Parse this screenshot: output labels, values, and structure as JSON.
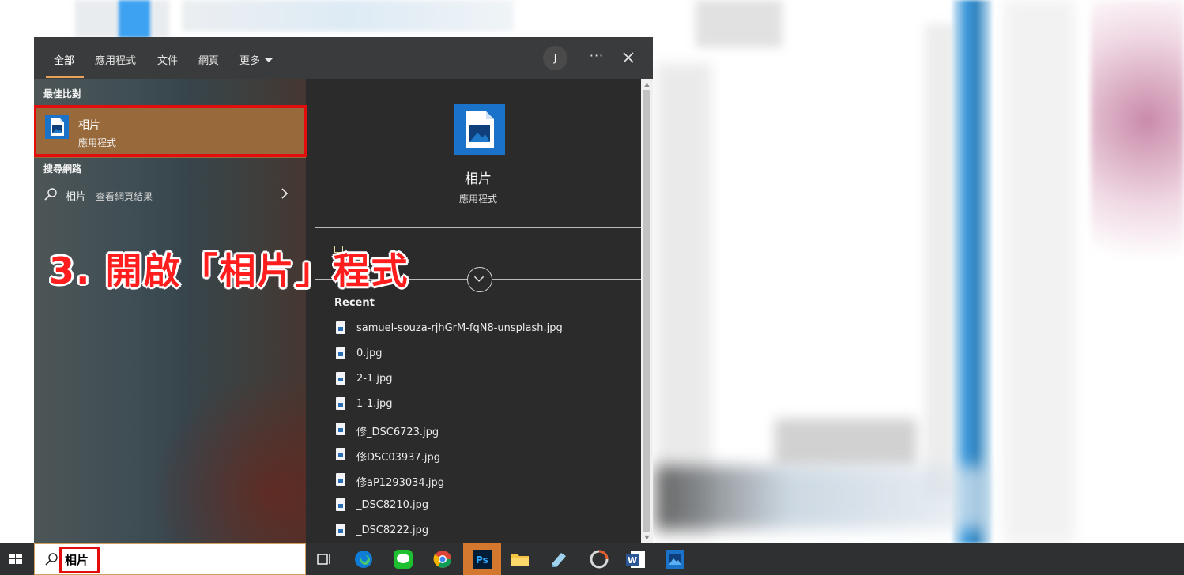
{
  "tabs": [
    {
      "label": "全部",
      "active": true
    },
    {
      "label": "應用程式"
    },
    {
      "label": "文件"
    },
    {
      "label": "網頁"
    },
    {
      "label": "更多"
    }
  ],
  "header": {
    "avatar_initial": "J",
    "more_options": "···"
  },
  "best_match": {
    "section_label": "最佳比對",
    "title": "相片",
    "subtitle": "應用程式"
  },
  "web_search": {
    "section_label": "搜尋網路",
    "query": "相片",
    "suffix": " - 查看網頁結果"
  },
  "detail": {
    "title": "相片",
    "subtitle": "應用程式",
    "recent_title": "Recent",
    "recent_files": [
      "samuel-souza-rjhGrM-fqN8-unsplash.jpg",
      "0.jpg",
      "2-1.jpg",
      "1-1.jpg",
      "修_DSC6723.jpg",
      "修DSC03937.jpg",
      "修aP1293034.jpg",
      "_DSC8210.jpg",
      "_DSC8222.jpg"
    ]
  },
  "annotation": "3. 開啟「相片」程式",
  "taskbar": {
    "search_text": "相片",
    "icons": [
      "task-view-icon",
      "edge-icon",
      "line-icon",
      "chrome-icon",
      "photoshop-icon",
      "file-explorer-icon",
      "notes-icon",
      "recorder-icon",
      "word-icon",
      "photos-icon"
    ]
  },
  "colors": {
    "accent": "#98693a",
    "highlight": "#e30d0d",
    "annotation": "#ff1d1d",
    "tab_underline": "#e8a25a",
    "panel": "#2b2b2b",
    "taskbar": "#2f3032"
  }
}
